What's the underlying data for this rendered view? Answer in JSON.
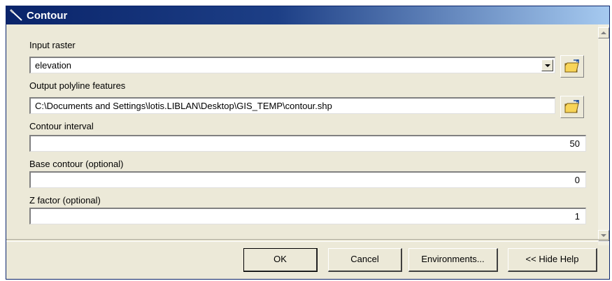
{
  "window": {
    "title": "Contour",
    "icon": "contour-pencil-icon"
  },
  "form": {
    "input_raster": {
      "label": "Input raster",
      "value": "elevation",
      "browse_icon": "open-folder-icon"
    },
    "output_polyline": {
      "label": "Output polyline features",
      "value": "C:\\Documents and Settings\\lotis.LIBLAN\\Desktop\\GIS_TEMP\\contour.shp",
      "browse_icon": "open-folder-icon"
    },
    "contour_interval": {
      "label": "Contour interval",
      "value": "50"
    },
    "base_contour": {
      "label": "Base contour (optional)",
      "value": "0"
    },
    "z_factor": {
      "label": "Z factor (optional)",
      "value": "1"
    }
  },
  "buttons": {
    "ok": "OK",
    "cancel": "Cancel",
    "environments": "Environments...",
    "hide_help": "<< Hide Help"
  },
  "colors": {
    "titlebar_start": "#0a246a",
    "titlebar_end": "#a6caf0",
    "dialog_bg": "#ece9d8"
  }
}
